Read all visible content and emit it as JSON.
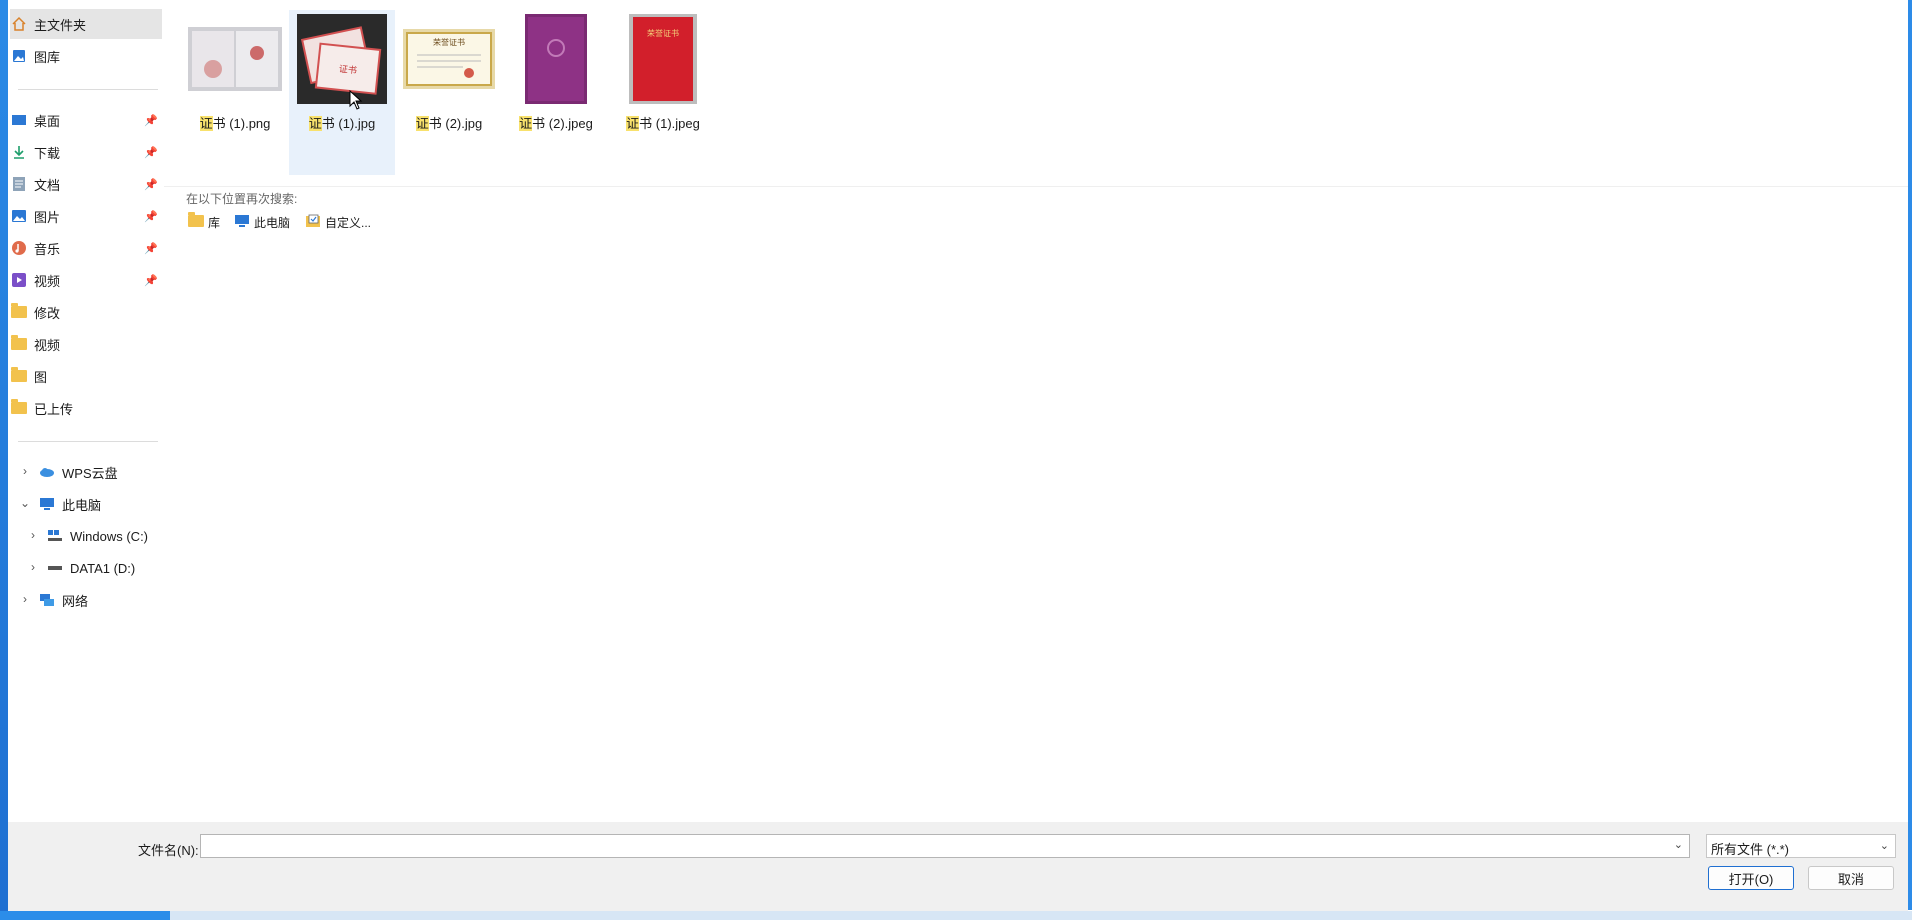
{
  "sidebar": {
    "home": "主文件夹",
    "gallery": "图库",
    "quick_access": [
      {
        "label": "桌面",
        "icon": "desktop-icon",
        "pinned": true
      },
      {
        "label": "下载",
        "icon": "download-icon",
        "pinned": true
      },
      {
        "label": "文档",
        "icon": "document-icon",
        "pinned": true
      },
      {
        "label": "图片",
        "icon": "picture-icon",
        "pinned": true
      },
      {
        "label": "音乐",
        "icon": "music-icon",
        "pinned": true
      },
      {
        "label": "视频",
        "icon": "video-icon",
        "pinned": true
      },
      {
        "label": "修改",
        "icon": "folder-icon",
        "pinned": false
      },
      {
        "label": "视频",
        "icon": "folder-icon",
        "pinned": false
      },
      {
        "label": "图",
        "icon": "folder-icon",
        "pinned": false
      },
      {
        "label": "已上传",
        "icon": "folder-icon",
        "pinned": false
      }
    ],
    "tree": {
      "wps": "WPS云盘",
      "this_pc": "此电脑",
      "drive_c": "Windows (C:)",
      "drive_d": "DATA1 (D:)",
      "network": "网络"
    }
  },
  "files": [
    {
      "highlight": "证",
      "rest": "书 (1).png",
      "selected": false
    },
    {
      "highlight": "证",
      "rest": "书 (1).jpg",
      "selected": true
    },
    {
      "highlight": "证",
      "rest": "书 (2).jpg",
      "selected": false
    },
    {
      "highlight": "证",
      "rest": "书 (2).jpeg",
      "selected": false
    },
    {
      "highlight": "证",
      "rest": "书 (1).jpeg",
      "selected": false
    }
  ],
  "search_again": {
    "label": "在以下位置再次搜索:",
    "library": "库",
    "this_pc": "此电脑",
    "custom": "自定义..."
  },
  "thumb_text": {
    "file2": "证书",
    "file3": "荣誉证书",
    "file5": "荣誉证书"
  },
  "footer": {
    "filename_label": "文件名(N):",
    "filename_value": "",
    "filetype": "所有文件 (*.*)",
    "open": "打开(O)",
    "cancel": "取消"
  },
  "colors": {
    "accent": "#1f6fd1",
    "selection": "#e8f1fb",
    "highlight": "#f8e16c"
  }
}
